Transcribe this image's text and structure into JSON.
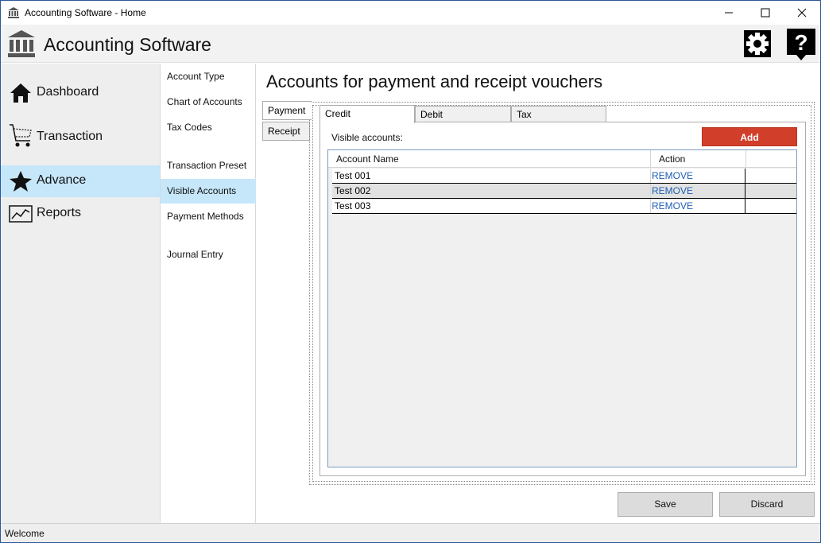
{
  "window": {
    "title": "Accounting Software - Home"
  },
  "header": {
    "app_title": "Accounting Software"
  },
  "nav": {
    "items": [
      {
        "label": "Dashboard",
        "icon": "home-icon"
      },
      {
        "label": "Transaction",
        "icon": "cart-icon"
      },
      {
        "label": "Advance",
        "icon": "star-icon",
        "active": true
      },
      {
        "label": "Reports",
        "icon": "chart-icon"
      }
    ]
  },
  "subnav": {
    "items": [
      {
        "label": "Account Type"
      },
      {
        "label": "Chart of Accounts"
      },
      {
        "label": "Tax Codes"
      },
      {
        "label": "Transaction Preset"
      },
      {
        "label": "Visible Accounts",
        "active": true
      },
      {
        "label": "Payment Methods"
      },
      {
        "label": "Journal Entry"
      }
    ]
  },
  "main": {
    "page_title": "Accounts for payment and receipt vouchers",
    "vertical_tabs": [
      "Payment",
      "Receipt"
    ],
    "horizontal_tabs": [
      "Credit",
      "Debit",
      "Tax"
    ],
    "visible_label": "Visible accounts:",
    "add_label": "Add",
    "table": {
      "columns": [
        "Account Name",
        "Action"
      ],
      "rows": [
        {
          "name": "Test 001",
          "action": "REMOVE"
        },
        {
          "name": "Test 002",
          "action": "REMOVE"
        },
        {
          "name": "Test 003",
          "action": "REMOVE"
        }
      ]
    },
    "save_label": "Save",
    "discard_label": "Discard"
  },
  "status": {
    "text": "Welcome"
  },
  "colors": {
    "accent_add": "#d13f2a",
    "nav_active": "#c6e6fa",
    "link": "#1f5fb4"
  }
}
